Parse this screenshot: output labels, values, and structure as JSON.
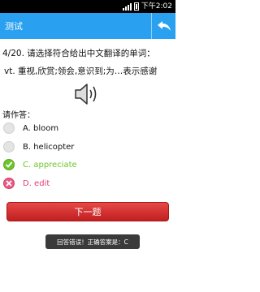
{
  "status_bar": {
    "time": "下午2:02"
  },
  "app_bar": {
    "title": "测试",
    "back_icon": "back-arrow-icon"
  },
  "question": {
    "header": "4/20. 请选择符合给出中文翻译的单词：",
    "meaning": "vt. 重视,欣赏;领会,意识到;为…表示感谢",
    "audio_icon": "speaker-icon"
  },
  "prompt": "请作答：",
  "options": [
    {
      "label": "A. bloom",
      "state": "unselected"
    },
    {
      "label": "B. helicopter",
      "state": "unselected"
    },
    {
      "label": "C. appreciate",
      "state": "correct"
    },
    {
      "label": "D. edit",
      "state": "wrong"
    }
  ],
  "next_button": "下一题",
  "toast": "回答错误！正确答案是：C",
  "colors": {
    "title_bar": "#2aa0f0",
    "correct": "#6cc52a",
    "wrong": "#e85a86",
    "next_button": "#d93232"
  }
}
